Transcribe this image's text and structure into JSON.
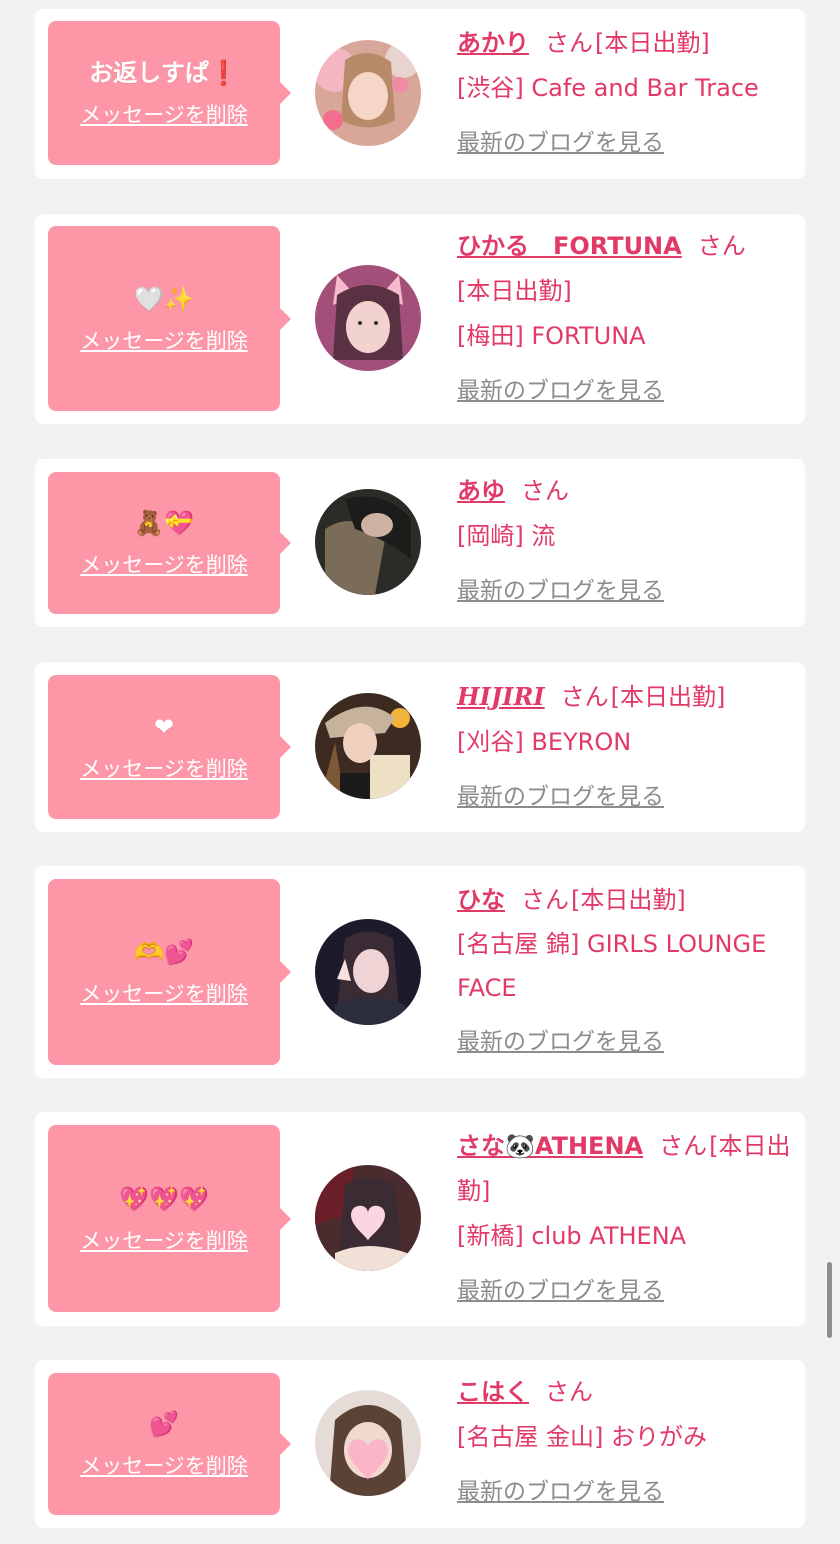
{
  "ui": {
    "delete_label": "メッセージを削除",
    "san_label": "さん",
    "blog_label": "最新のブログを見る"
  },
  "colors": {
    "bubble": "#fd97a7",
    "name": "#e23a67",
    "link_gray": "#8c8c8c",
    "background": "#f2f2f2"
  },
  "entries": [
    {
      "message": "お返しすぱ❗",
      "name": "あかり",
      "status": "[本日出勤]",
      "shop": "[渋谷] Cafe and Bar Trace",
      "avatar_icon": "photo-pink-tones"
    },
    {
      "message": "🤍✨",
      "name": "ひかる　FORTUNA",
      "status": "[本日出勤]",
      "shop": "[梅田] FORTUNA",
      "avatar_icon": "photo-cat-filter"
    },
    {
      "message": "🧸💝",
      "name": "あゆ",
      "status": "",
      "shop": "[岡崎] 流",
      "avatar_icon": "photo-dark"
    },
    {
      "message": "❤",
      "name": "HIJIRI",
      "status": "[本日出勤]",
      "shop": "[刈谷] BEYRON",
      "avatar_icon": "photo-cap"
    },
    {
      "message": "🫶💕",
      "name": "ひな",
      "status": "[本日出勤]",
      "shop": "[名古屋 錦] GIRLS LOUNGE FACE",
      "avatar_icon": "photo-peace-sign"
    },
    {
      "message": "💖💖💖",
      "name": "さな🐼ATHENA",
      "status": "[本日出勤]",
      "shop": "[新橋] club ATHENA",
      "avatar_icon": "photo-heart-sticker"
    },
    {
      "message": "💕",
      "name": "こはく",
      "status": "",
      "shop": "[名古屋 金山] おりがみ",
      "avatar_icon": "photo-heart-sticker"
    }
  ]
}
